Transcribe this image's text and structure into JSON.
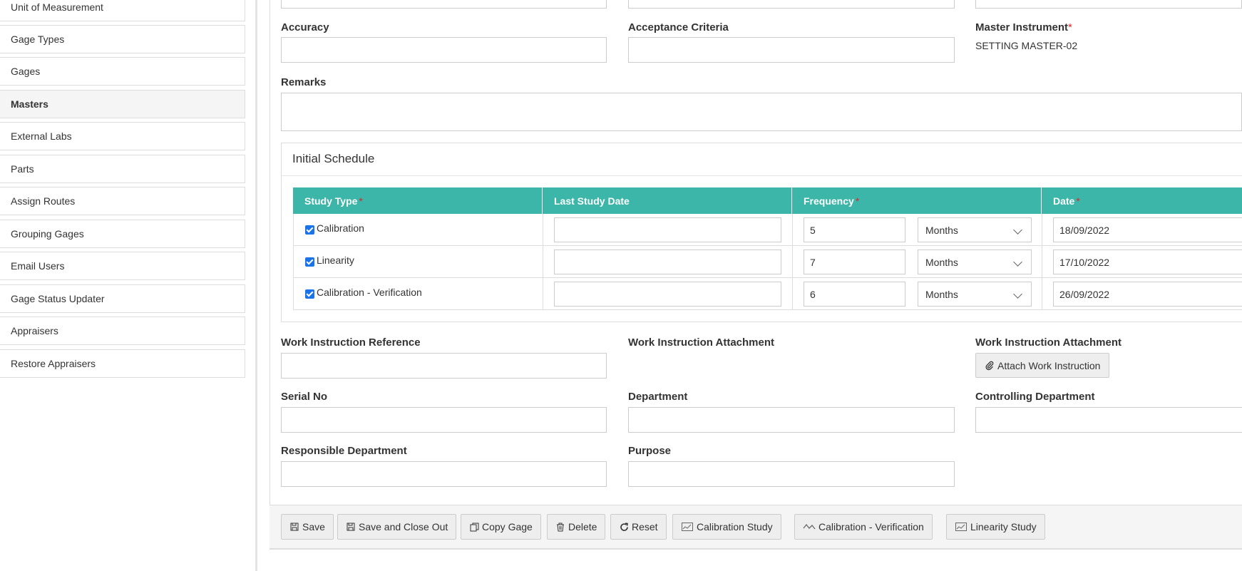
{
  "sidebar": {
    "items": [
      {
        "label": "Unit of Measurement",
        "active": false
      },
      {
        "label": "Gage Types",
        "active": false
      },
      {
        "label": "Gages",
        "active": false
      },
      {
        "label": "Masters",
        "active": true
      },
      {
        "label": "External Labs",
        "active": false
      },
      {
        "label": "Parts",
        "active": false
      },
      {
        "label": "Assign Routes",
        "active": false
      },
      {
        "label": "Grouping Gages",
        "active": false
      },
      {
        "label": "Email Users",
        "active": false
      },
      {
        "label": "Gage Status Updater",
        "active": false
      },
      {
        "label": "Appraisers",
        "active": false
      },
      {
        "label": "Restore Appraisers",
        "active": false
      }
    ]
  },
  "form": {
    "accuracy": {
      "label": "Accuracy",
      "value": ""
    },
    "acceptance_criteria": {
      "label": "Acceptance Criteria",
      "value": ""
    },
    "master_instrument": {
      "label": "Master Instrument",
      "required_mark": "*",
      "value": "SETTING MASTER-02"
    },
    "remarks": {
      "label": "Remarks",
      "value": ""
    },
    "work_instruction_reference": {
      "label": "Work Instruction Reference",
      "value": ""
    },
    "work_instruction_attachment_1": {
      "label": "Work Instruction Attachment"
    },
    "work_instruction_attachment_2": {
      "label": "Work Instruction Attachment",
      "button": "Attach Work Instruction"
    },
    "serial_no": {
      "label": "Serial No",
      "value": ""
    },
    "department": {
      "label": "Department",
      "value": ""
    },
    "controlling_department": {
      "label": "Controlling Department",
      "value": ""
    },
    "responsible_department": {
      "label": "Responsible Department",
      "value": ""
    },
    "purpose": {
      "label": "Purpose",
      "value": ""
    }
  },
  "schedule": {
    "title": "Initial Schedule",
    "columns": {
      "study_type": "Study Type",
      "last_study_date": "Last Study Date",
      "frequency": "Frequency",
      "date": "Date",
      "required_mark": "*"
    },
    "rows": [
      {
        "study_type": "Calibration",
        "checked": true,
        "last_study_date": "",
        "frequency": "5",
        "unit": "Months",
        "date": "18/09/2022"
      },
      {
        "study_type": "Linearity",
        "checked": true,
        "last_study_date": "",
        "frequency": "7",
        "unit": "Months",
        "date": "17/10/2022"
      },
      {
        "study_type": "Calibration - Verification",
        "checked": true,
        "last_study_date": "",
        "frequency": "6",
        "unit": "Months",
        "date": "26/09/2022"
      }
    ]
  },
  "footer": {
    "buttons": [
      {
        "label": "Save",
        "icon": "save-icon"
      },
      {
        "label": "Save and Close Out",
        "icon": "save-icon"
      },
      {
        "label": "Copy Gage",
        "icon": "copy-icon"
      },
      {
        "label": "Delete",
        "icon": "trash-icon"
      },
      {
        "label": "Reset",
        "icon": "refresh-icon"
      },
      {
        "label": "Calibration Study",
        "icon": "chart-icon"
      },
      {
        "label": "Calibration - Verification",
        "icon": "line-chart-icon"
      },
      {
        "label": "Linearity Study",
        "icon": "chart-icon"
      }
    ]
  },
  "colors": {
    "table_header": "#3cb6a9",
    "required": "#e0262c",
    "checkbox": "#1a73e8"
  }
}
